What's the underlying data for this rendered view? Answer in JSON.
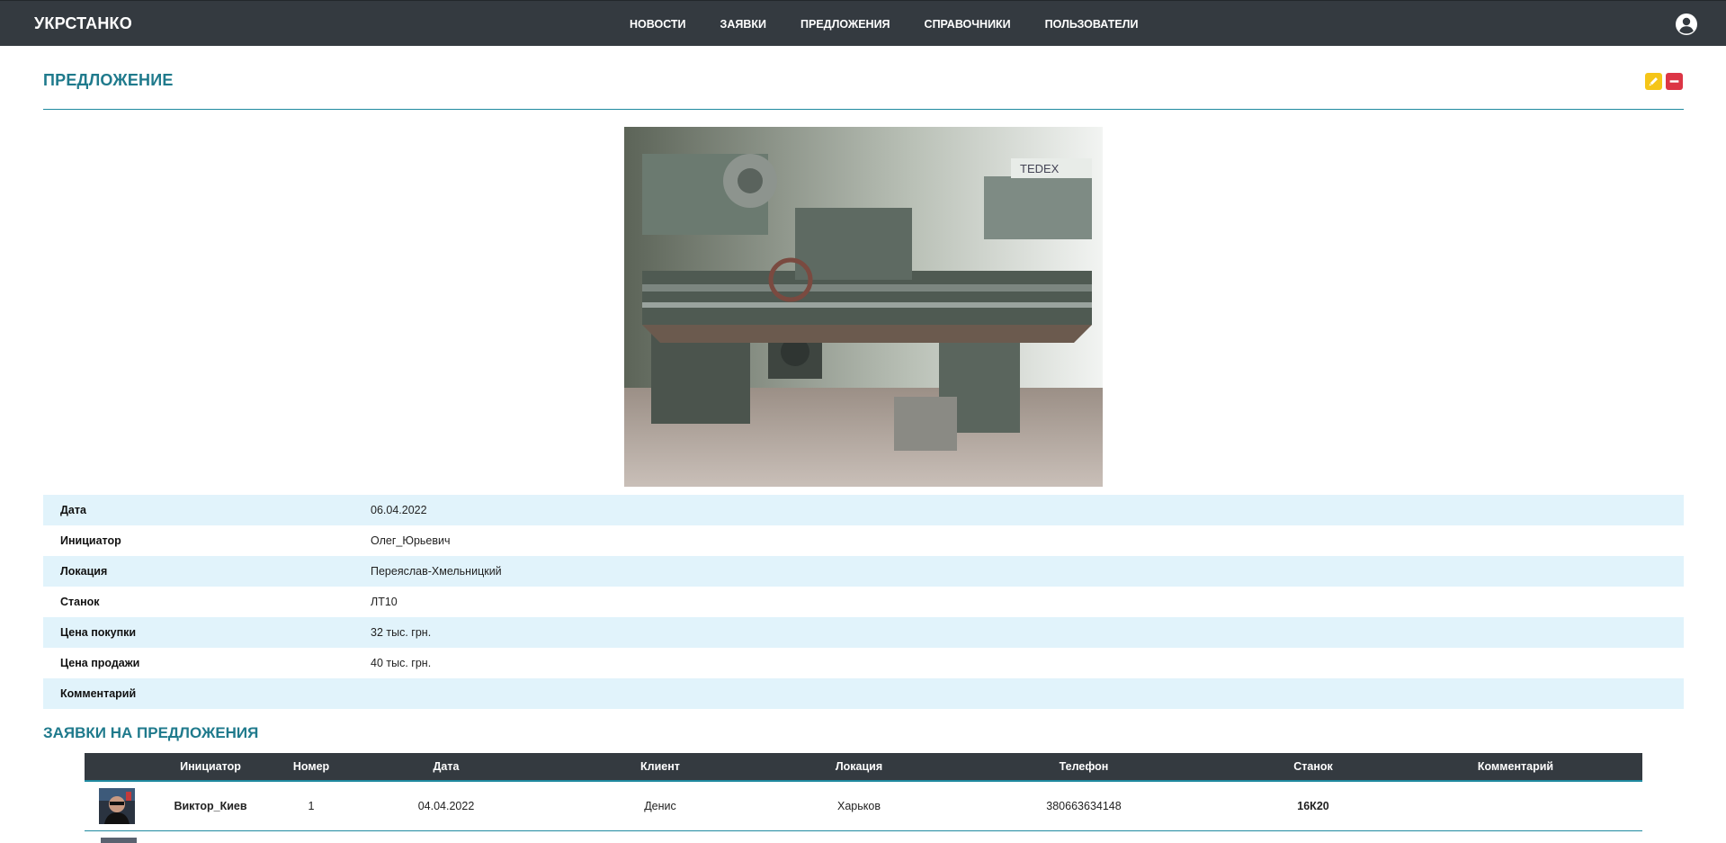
{
  "header": {
    "brand": "УКРСТАНКО",
    "nav": [
      "НОВОСТИ",
      "ЗАЯВКИ",
      "ПРЕДЛОЖЕНИЯ",
      "СПРАВОЧНИКИ",
      "ПОЛЬЗОВАТЕЛИ"
    ],
    "user_icon": "user-circle-icon"
  },
  "page": {
    "title": "ПРЕДЛОЖЕНИЕ",
    "actions": {
      "edit_icon": "pencil-icon",
      "delete_icon": "minus-icon",
      "edit_color": "#f5c518",
      "delete_color": "#dc3545"
    }
  },
  "details": [
    {
      "label": "Дата",
      "value": "06.04.2022"
    },
    {
      "label": "Инициатор",
      "value": "Олег_Юрьевич"
    },
    {
      "label": "Локация",
      "value": "Переяслав-Хмельницкий"
    },
    {
      "label": "Станок",
      "value": "ЛТ10"
    },
    {
      "label": "Цена покупки",
      "value": "32 тыс. грн."
    },
    {
      "label": "Цена продажи",
      "value": "40 тыс. грн."
    },
    {
      "label": "Комментарий",
      "value": ""
    }
  ],
  "requests": {
    "title": "ЗАЯВКИ НА ПРЕДЛОЖЕНИЯ",
    "columns": [
      "Инициатор",
      "Номер",
      "Дата",
      "Клиент",
      "Локация",
      "Телефон",
      "Станок",
      "Комментарий"
    ],
    "rows": [
      {
        "initiator": "Виктор_Киев",
        "number": "1",
        "date": "04.04.2022",
        "client": "Денис",
        "location": "Харьков",
        "phone": "380663634148",
        "tool": "16К20",
        "comment": ""
      }
    ]
  },
  "photo": {
    "watermark": "TEDEX"
  },
  "colors": {
    "accent": "#1f7a8c",
    "header_bg": "#343a40",
    "row_alt": "#e1f3fb"
  }
}
